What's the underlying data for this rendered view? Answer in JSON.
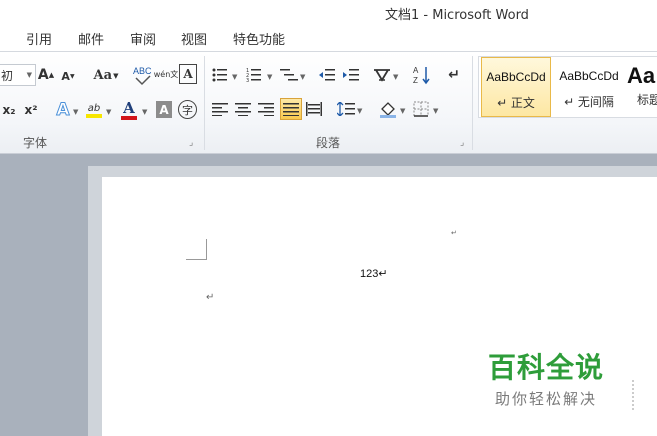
{
  "window": {
    "title": "文档1 - Microsoft Word"
  },
  "tabs": [
    "引用",
    "邮件",
    "审阅",
    "视图",
    "特色功能"
  ],
  "ribbon": {
    "font_group": {
      "label": "字体",
      "font_size_partial": "初",
      "grow_font": "A",
      "shrink_font": "A",
      "change_case": "Aa",
      "phonetic_guide": "wén文",
      "char_border": "A",
      "subscript": "x₂",
      "superscript": "x²",
      "text_effect": "A",
      "highlight": "ab",
      "font_color": "A",
      "char_shading": "A",
      "enclose_char": "字"
    },
    "paragraph_group": {
      "label": "段落"
    },
    "styles": [
      {
        "sample": "AaBbCcDd",
        "name": "↵ 正文",
        "selected": true
      },
      {
        "sample": "AaBbCcDd",
        "name": "↵ 无间隔",
        "selected": false
      },
      {
        "sample": "Aa",
        "name": "标题",
        "selected": false
      }
    ]
  },
  "document": {
    "text": "123↵",
    "para_mark": "↵",
    "small_mark": "↵"
  },
  "watermark": {
    "main": "百科全说",
    "sub": "助你轻松解决"
  },
  "colors": {
    "highlight": "#f7e600",
    "font_color": "#d2141a",
    "watermark_green": "#2e9d3a",
    "selected_style_border": "#e9b949"
  }
}
